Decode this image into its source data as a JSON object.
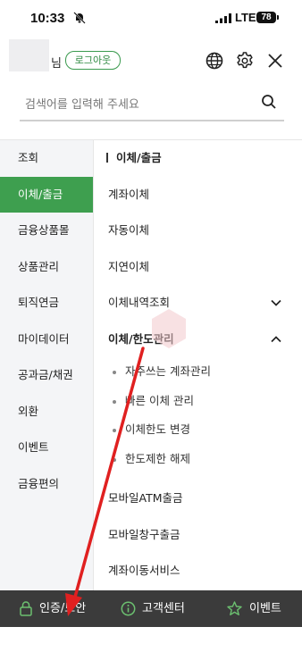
{
  "status_bar": {
    "time": "10:33",
    "network": "LTE",
    "battery": "78"
  },
  "header": {
    "user_suffix": "님",
    "logout_label": "로그아웃"
  },
  "search": {
    "placeholder": "검색어를 입력해 주세요"
  },
  "left_menu": [
    {
      "label": "조회",
      "active": false
    },
    {
      "label": "이체/출금",
      "active": true
    },
    {
      "label": "금융상품몰",
      "active": false
    },
    {
      "label": "상품관리",
      "active": false
    },
    {
      "label": "퇴직연금",
      "active": false
    },
    {
      "label": "마이데이터",
      "active": false
    },
    {
      "label": "공과금/채권",
      "active": false
    },
    {
      "label": "외환",
      "active": false
    },
    {
      "label": "이벤트",
      "active": false
    },
    {
      "label": "금융편의",
      "active": false
    }
  ],
  "right_menu": {
    "section_title": "이체/출금",
    "items": [
      "계좌이체",
      "자동이체",
      "지연이체",
      "이체내역조회"
    ],
    "expanded_group": {
      "label": "이체/한도관리",
      "subitems": [
        "자주쓰는 계좌관리",
        "빠른 이체 관리",
        "이체한도 변경",
        "한도제한 해제"
      ]
    },
    "more_items": [
      "모바일ATM출금",
      "모바일창구출금",
      "계좌이동서비스"
    ]
  },
  "bottom_bar": {
    "auth_label": "인증/보안",
    "customer_label": "고객센터",
    "event_label": "이벤트"
  },
  "colors": {
    "accent": "#3e9f4f",
    "bottom_bar": "#3b3b3b",
    "arrow": "#e02020"
  }
}
